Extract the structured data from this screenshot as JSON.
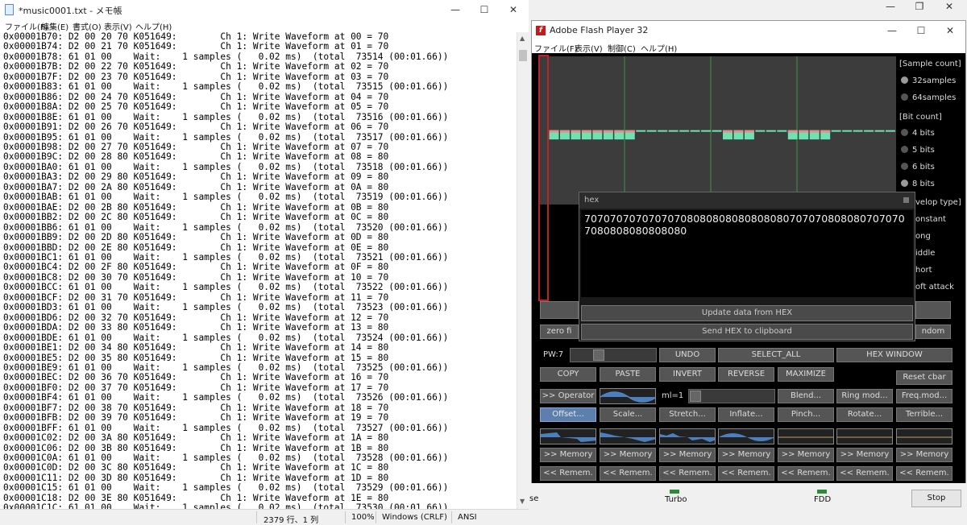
{
  "notepad": {
    "title": "*music0001.txt - メモ帳",
    "menu": [
      "ファイル(F)",
      "編集(E)",
      "書式(O)",
      "表示(V)",
      "ヘルプ(H)"
    ],
    "lines": [
      "0x00001B70: D2 00 20 70 K051649:        Ch 1: Write Waveform at 00 = 70",
      "0x00001B74: D2 00 21 70 K051649:        Ch 1: Write Waveform at 01 = 70",
      "0x00001B78: 61 01 00    Wait:    1 samples (   0.02 ms)  (total  73514 (00:01.66))",
      "0x00001B7B: D2 00 22 70 K051649:        Ch 1: Write Waveform at 02 = 70",
      "0x00001B7F: D2 00 23 70 K051649:        Ch 1: Write Waveform at 03 = 70",
      "0x00001B83: 61 01 00    Wait:    1 samples (   0.02 ms)  (total  73515 (00:01.66))",
      "0x00001B86: D2 00 24 70 K051649:        Ch 1: Write Waveform at 04 = 70",
      "0x00001B8A: D2 00 25 70 K051649:        Ch 1: Write Waveform at 05 = 70",
      "0x00001B8E: 61 01 00    Wait:    1 samples (   0.02 ms)  (total  73516 (00:01.66))",
      "0x00001B91: D2 00 26 70 K051649:        Ch 1: Write Waveform at 06 = 70",
      "0x00001B95: 61 01 00    Wait:    1 samples (   0.02 ms)  (total  73517 (00:01.66))",
      "0x00001B98: D2 00 27 70 K051649:        Ch 1: Write Waveform at 07 = 70",
      "0x00001B9C: D2 00 28 80 K051649:        Ch 1: Write Waveform at 08 = 80",
      "0x00001BA0: 61 01 00    Wait:    1 samples (   0.02 ms)  (total  73518 (00:01.66))",
      "0x00001BA3: D2 00 29 80 K051649:        Ch 1: Write Waveform at 09 = 80",
      "0x00001BA7: D2 00 2A 80 K051649:        Ch 1: Write Waveform at 0A = 80",
      "0x00001BAB: 61 01 00    Wait:    1 samples (   0.02 ms)  (total  73519 (00:01.66))",
      "0x00001BAE: D2 00 2B 80 K051649:        Ch 1: Write Waveform at 0B = 80",
      "0x00001BB2: D2 00 2C 80 K051649:        Ch 1: Write Waveform at 0C = 80",
      "0x00001BB6: 61 01 00    Wait:    1 samples (   0.02 ms)  (total  73520 (00:01.66))",
      "0x00001BB9: D2 00 2D 80 K051649:        Ch 1: Write Waveform at 0D = 80",
      "0x00001BBD: D2 00 2E 80 K051649:        Ch 1: Write Waveform at 0E = 80",
      "0x00001BC1: 61 01 00    Wait:    1 samples (   0.02 ms)  (total  73521 (00:01.66))",
      "0x00001BC4: D2 00 2F 80 K051649:        Ch 1: Write Waveform at 0F = 80",
      "0x00001BC8: D2 00 30 70 K051649:        Ch 1: Write Waveform at 10 = 70",
      "0x00001BCC: 61 01 00    Wait:    1 samples (   0.02 ms)  (total  73522 (00:01.66))",
      "0x00001BCF: D2 00 31 70 K051649:        Ch 1: Write Waveform at 11 = 70",
      "0x00001BD3: 61 01 00    Wait:    1 samples (   0.02 ms)  (total  73523 (00:01.66))",
      "0x00001BD6: D2 00 32 70 K051649:        Ch 1: Write Waveform at 12 = 70",
      "0x00001BDA: D2 00 33 80 K051649:        Ch 1: Write Waveform at 13 = 80",
      "0x00001BDE: 61 01 00    Wait:    1 samples (   0.02 ms)  (total  73524 (00:01.66))",
      "0x00001BE1: D2 00 34 80 K051649:        Ch 1: Write Waveform at 14 = 80",
      "0x00001BE5: D2 00 35 80 K051649:        Ch 1: Write Waveform at 15 = 80",
      "0x00001BE9: 61 01 00    Wait:    1 samples (   0.02 ms)  (total  73525 (00:01.66))",
      "0x00001BEC: D2 00 36 70 K051649:        Ch 1: Write Waveform at 16 = 70",
      "0x00001BF0: D2 00 37 70 K051649:        Ch 1: Write Waveform at 17 = 70",
      "0x00001BF4: 61 01 00    Wait:    1 samples (   0.02 ms)  (total  73526 (00:01.66))",
      "0x00001BF7: D2 00 38 70 K051649:        Ch 1: Write Waveform at 18 = 70",
      "0x00001BFB: D2 00 39 70 K051649:        Ch 1: Write Waveform at 19 = 70",
      "0x00001BFF: 61 01 00    Wait:    1 samples (   0.02 ms)  (total  73527 (00:01.66))",
      "0x00001C02: D2 00 3A 80 K051649:        Ch 1: Write Waveform at 1A = 80",
      "0x00001C06: D2 00 3B 80 K051649:        Ch 1: Write Waveform at 1B = 80",
      "0x00001C0A: 61 01 00    Wait:    1 samples (   0.02 ms)  (total  73528 (00:01.66))",
      "0x00001C0D: D2 00 3C 80 K051649:        Ch 1: Write Waveform at 1C = 80",
      "0x00001C11: D2 00 3D 80 K051649:        Ch 1: Write Waveform at 1D = 80",
      "0x00001C15: 61 01 00    Wait:    1 samples (   0.02 ms)  (total  73529 (00:01.66))",
      "0x00001C18: D2 00 3E 80 K051649:        Ch 1: Write Waveform at 1E = 80",
      "0x00001C1C: 61 01 00    Wait:    1 samples (   0.02 ms)  (total  73530 (00:01.66))"
    ],
    "status": {
      "position": "2379 行、1 列",
      "zoom": "100%",
      "eol": "Windows (CRLF)",
      "encoding": "ANSI"
    }
  },
  "background_window": {
    "partial_label": "se",
    "turbo_label": "Turbo",
    "fdd_label": "FDD",
    "stop_label": "Stop",
    "led_color": "#2f8a3a"
  },
  "flash": {
    "title": "Adobe Flash Player 32",
    "logo_glyph": "f",
    "menu": [
      "ファイル(F)",
      "表示(V)",
      "制御(C)",
      "ヘルプ(H)"
    ],
    "waveform": {
      "samples": [
        112,
        112,
        112,
        112,
        112,
        112,
        112,
        112,
        128,
        128,
        128,
        128,
        128,
        128,
        128,
        128,
        112,
        112,
        112,
        128,
        128,
        128,
        112,
        112,
        112,
        112,
        128,
        128,
        128,
        128,
        128,
        128
      ],
      "color": "#6ee2b0",
      "cap_color": "#e0908a"
    },
    "options": {
      "sample_count_header": "[Sample count]",
      "sample_count": [
        {
          "label": "32samples",
          "selected": true
        },
        {
          "label": "64samples",
          "selected": false
        }
      ],
      "bit_count_header": "[Bit count]",
      "bit_count": [
        {
          "label": "4 bits",
          "selected": false
        },
        {
          "label": "5 bits",
          "selected": false
        },
        {
          "label": "6 bits",
          "selected": false
        },
        {
          "label": "8 bits",
          "selected": true
        }
      ],
      "envelope_header": "velop type]",
      "envelope": [
        "onstant",
        "ong",
        "iddle",
        "hort",
        "oft attack"
      ]
    },
    "hex_dialog": {
      "title": "hex",
      "text": "707070707070707080808080808080807070708080807070707080808080808080",
      "update_btn": "Update data from HEX",
      "send_btn": "Send HEX to clipboard"
    },
    "partial_row": {
      "left": "zero fi",
      "right": "ndom"
    },
    "pw_label": "PW:7",
    "buttons_row1": [
      "UNDO",
      "SELECT_ALL",
      "HEX WINDOW"
    ],
    "buttons_row2": [
      "COPY",
      "PASTE",
      "INVERT",
      "REVERSE",
      "MAXIMIZE"
    ],
    "reset_label": "Reset cbar",
    "operator_label": ">> Operator",
    "ml_label": "ml=1",
    "buttons_row3": [
      "Blend...",
      "Ring mod...",
      "Freq.mod..."
    ],
    "buttons_row4": [
      "Offset...",
      "Scale...",
      "Stretch...",
      "Inflate...",
      "Pinch...",
      "Rotate...",
      "Terrible..."
    ],
    "memory_label": ">> Memory",
    "rememb_label": "<< Remem."
  }
}
